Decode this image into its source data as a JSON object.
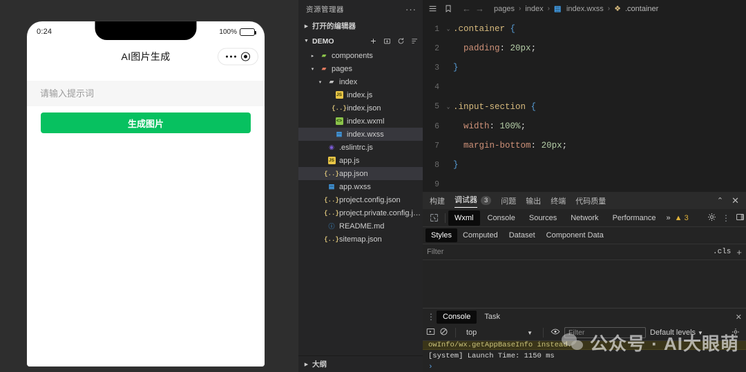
{
  "simulator": {
    "status_time": "0:24",
    "battery_pct": "100%",
    "nav_title": "AI图片生成",
    "capsule": {
      "more_icon": "more-dots-icon",
      "target_icon": "target-circle-icon"
    },
    "prompt_placeholder": "请输入提示词",
    "prompt_value": "",
    "generate_label": "生成图片",
    "accent_green": "#07c160"
  },
  "explorer": {
    "title": "资源管理器",
    "more_label": "···",
    "open_editors_label": "打开的编辑器",
    "project_label": "DEMO",
    "actions": [
      "new-file-icon",
      "new-folder-icon",
      "refresh-icon",
      "collapse-all-icon"
    ],
    "outline_label": "大纲",
    "tree": [
      {
        "label": "components",
        "icon": "folder-components-icon",
        "depth": 1,
        "twisty": "▸",
        "selected": false
      },
      {
        "label": "pages",
        "icon": "folder-pages-icon",
        "depth": 1,
        "twisty": "▾",
        "selected": false
      },
      {
        "label": "index",
        "icon": "folder-icon",
        "depth": 2,
        "twisty": "▾",
        "selected": false
      },
      {
        "label": "index.js",
        "icon": "js-file-icon",
        "depth": 3,
        "twisty": "",
        "selected": false
      },
      {
        "label": "index.json",
        "icon": "json-file-icon",
        "depth": 3,
        "twisty": "",
        "selected": false
      },
      {
        "label": "index.wxml",
        "icon": "wxml-file-icon",
        "depth": 3,
        "twisty": "",
        "selected": false
      },
      {
        "label": "index.wxss",
        "icon": "wxss-file-icon",
        "depth": 3,
        "twisty": "",
        "selected": true
      },
      {
        "label": ".eslintrc.js",
        "icon": "eslint-file-icon",
        "depth": 2,
        "twisty": "",
        "selected": false
      },
      {
        "label": "app.js",
        "icon": "js-file-icon",
        "depth": 2,
        "twisty": "",
        "selected": false
      },
      {
        "label": "app.json",
        "icon": "json-file-icon",
        "depth": 2,
        "twisty": "",
        "selected": true
      },
      {
        "label": "app.wxss",
        "icon": "wxss-file-icon",
        "depth": 2,
        "twisty": "",
        "selected": false
      },
      {
        "label": "project.config.json",
        "icon": "json-file-icon",
        "depth": 2,
        "twisty": "",
        "selected": false
      },
      {
        "label": "project.private.config.js...",
        "icon": "json-file-icon",
        "depth": 2,
        "twisty": "",
        "selected": false
      },
      {
        "label": "README.md",
        "icon": "markdown-file-icon",
        "depth": 2,
        "twisty": "",
        "selected": false
      },
      {
        "label": "sitemap.json",
        "icon": "json-file-icon",
        "depth": 2,
        "twisty": "",
        "selected": false
      }
    ]
  },
  "breadcrumb": {
    "items": [
      "pages",
      "index",
      "index.wxss",
      ".container"
    ],
    "sep": "›"
  },
  "code": {
    "lines": [
      {
        "n": "1",
        "fold": "⌄",
        "segs": [
          {
            "t": ".container ",
            "c": "t-sel"
          },
          {
            "t": "{",
            "c": "t-brace"
          }
        ]
      },
      {
        "n": "2",
        "fold": "",
        "segs": [
          {
            "t": "  ",
            "c": ""
          },
          {
            "t": "padding",
            "c": "t-prop"
          },
          {
            "t": ": ",
            "c": "t-punc"
          },
          {
            "t": "20px",
            "c": "t-num"
          },
          {
            "t": ";",
            "c": "t-punc"
          }
        ]
      },
      {
        "n": "3",
        "fold": "",
        "segs": [
          {
            "t": "}",
            "c": "t-brace"
          }
        ]
      },
      {
        "n": "4",
        "fold": "",
        "segs": [
          {
            "t": "",
            "c": ""
          }
        ]
      },
      {
        "n": "5",
        "fold": "⌄",
        "segs": [
          {
            "t": ".input-section ",
            "c": "t-sel"
          },
          {
            "t": "{",
            "c": "t-brace"
          }
        ]
      },
      {
        "n": "6",
        "fold": "",
        "segs": [
          {
            "t": "  ",
            "c": ""
          },
          {
            "t": "width",
            "c": "t-prop"
          },
          {
            "t": ": ",
            "c": "t-punc"
          },
          {
            "t": "100%",
            "c": "t-num"
          },
          {
            "t": ";",
            "c": "t-punc"
          }
        ]
      },
      {
        "n": "7",
        "fold": "",
        "segs": [
          {
            "t": "  ",
            "c": ""
          },
          {
            "t": "margin-bottom",
            "c": "t-prop"
          },
          {
            "t": ": ",
            "c": "t-punc"
          },
          {
            "t": "20px",
            "c": "t-num"
          },
          {
            "t": ";",
            "c": "t-punc"
          }
        ]
      },
      {
        "n": "8",
        "fold": "",
        "segs": [
          {
            "t": "}",
            "c": "t-brace"
          }
        ]
      },
      {
        "n": "9",
        "fold": "",
        "segs": [
          {
            "t": "",
            "c": ""
          }
        ]
      }
    ]
  },
  "devtools": {
    "panel_tabs": [
      {
        "label": "构建",
        "active": false,
        "badge": ""
      },
      {
        "label": "调试器",
        "active": true,
        "badge": "3"
      },
      {
        "label": "问题",
        "active": false,
        "badge": ""
      },
      {
        "label": "输出",
        "active": false,
        "badge": ""
      },
      {
        "label": "终端",
        "active": false,
        "badge": ""
      },
      {
        "label": "代码质量",
        "active": false,
        "badge": ""
      }
    ],
    "collapse_icon": "chevron-up-icon",
    "close_icon": "close-icon",
    "chrome_tabs": [
      {
        "label": "Wxml",
        "active": true
      },
      {
        "label": "Console",
        "active": false
      },
      {
        "label": "Sources",
        "active": false
      },
      {
        "label": "Network",
        "active": false
      },
      {
        "label": "Performance",
        "active": false
      }
    ],
    "chrome_more": "»",
    "warning_count": "3",
    "styles_tabs": [
      {
        "label": "Styles",
        "active": true
      },
      {
        "label": "Computed",
        "active": false
      },
      {
        "label": "Dataset",
        "active": false
      },
      {
        "label": "Component Data",
        "active": false
      }
    ],
    "styles_filter_placeholder": "Filter",
    "cls_label": ".cls",
    "plus_label": "+",
    "console_tabs": [
      {
        "label": "Console",
        "active": true
      },
      {
        "label": "Task",
        "active": false
      }
    ],
    "console_context": "top",
    "console_filter_placeholder": "Filter",
    "console_levels": "Default levels",
    "console_lines": [
      {
        "type": "warning",
        "text": "owInfo/wx.getAppBaseInfo instead."
      },
      {
        "type": "log",
        "text": "[system] Launch Time: 1150 ms"
      }
    ],
    "console_prompt": "›"
  },
  "watermark": {
    "text": "公众号 · AI大眼萌"
  }
}
